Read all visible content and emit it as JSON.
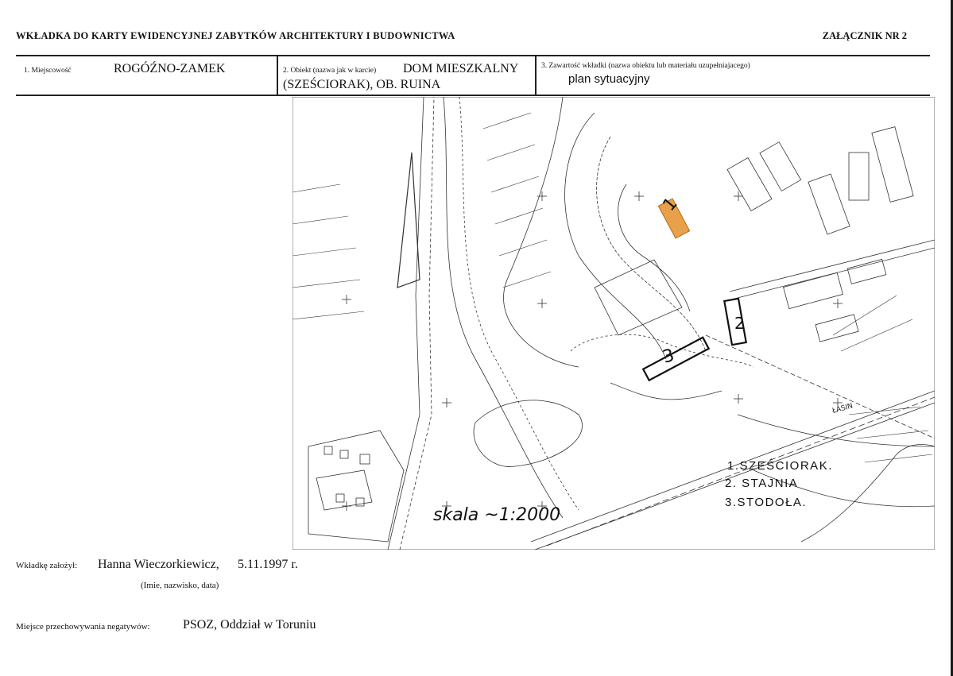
{
  "header": {
    "title": "WKŁADKA DO KARTY EWIDENCYJNEJ ZABYTKÓW ARCHITEKTURY I BUDOWNICTWA",
    "annex": "ZAŁĄCZNIK NR 2"
  },
  "fields": {
    "locality": {
      "label": "1. Miejscowość",
      "value": "ROGÓŹNO-ZAMEK"
    },
    "object": {
      "label": "2. Obiekt (nazwa jak w karcie)",
      "value_line1": "DOM MIESZKALNY",
      "value_line2": "(SZEŚCIORAK), OB. RUINA"
    },
    "content": {
      "label": "3. Zawartość wkładki (nazwa obiektu lub materiału uzupełniajacego)",
      "value": "plan sytuacyjny"
    }
  },
  "map": {
    "legend": [
      "1.SZEŚCIORAK.",
      "2. STAJNIA",
      "3.STODOŁA."
    ],
    "building_numbers": [
      "1",
      "2",
      "3"
    ],
    "scale": "skala ~1:2000",
    "street_label": "ŁASIN",
    "highlight_color": "#e8a04a"
  },
  "footer": {
    "author_label": "Wkładkę założył:",
    "author_value": "Hanna Wieczorkiewicz,",
    "date_value": "5.11.1997 r.",
    "author_note": "(Imie, nazwisko, data)",
    "storage_label": "Miejsce przechowywania negatywów:",
    "storage_value": "PSOZ, Oddział w Toruniu"
  }
}
